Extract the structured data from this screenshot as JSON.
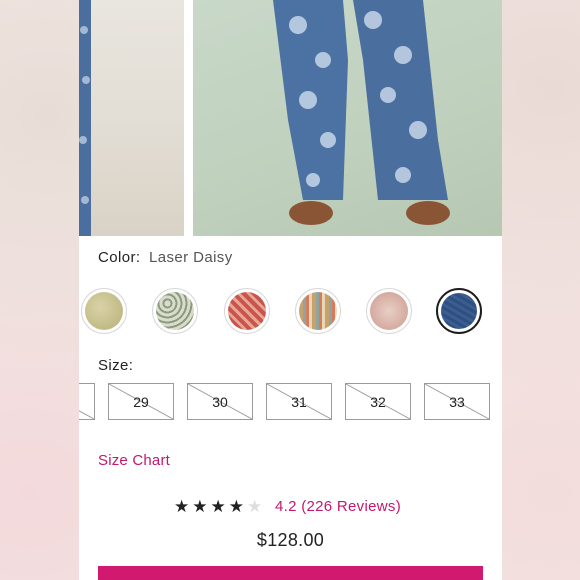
{
  "product": {
    "color_label": "Color:",
    "color_value": "Laser Daisy",
    "size_label": "Size:",
    "size_chart_link": "Size Chart",
    "price": "$128.00",
    "rating": {
      "stars_value": 4.2,
      "stars_max": 5,
      "text": "4.2 (226 Reviews)"
    }
  },
  "swatches": [
    {
      "name": "pale-floral",
      "selected": false
    },
    {
      "name": "green-leopard",
      "selected": false
    },
    {
      "name": "red-paisley",
      "selected": false
    },
    {
      "name": "stripe-multi",
      "selected": false
    },
    {
      "name": "pink-toile",
      "selected": false
    },
    {
      "name": "laser-daisy-denim",
      "selected": true
    }
  ],
  "sizes": [
    {
      "label": "",
      "available": false
    },
    {
      "label": "29",
      "available": false
    },
    {
      "label": "30",
      "available": true
    },
    {
      "label": "31",
      "available": false
    },
    {
      "label": "32",
      "available": false
    },
    {
      "label": "33",
      "available": true
    }
  ],
  "colors": {
    "accent": "#c2186d",
    "cta": "#d1196f",
    "text": "#222222",
    "denim": "#4a6d9b"
  }
}
